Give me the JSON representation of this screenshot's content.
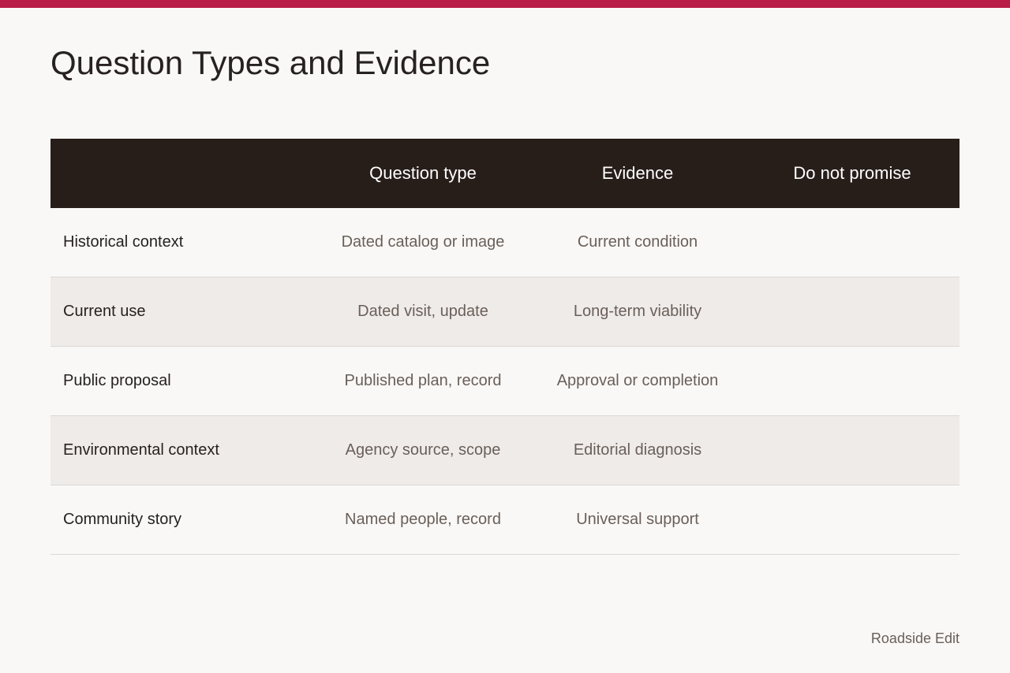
{
  "page": {
    "title": "Question Types and Evidence",
    "accent_color": "#b91d47",
    "footer": "Roadside Edit"
  },
  "table": {
    "headers": [
      "",
      "Question type",
      "Evidence",
      "Do not promise"
    ],
    "rows": [
      {
        "label": "Historical context",
        "question_type": "Dated catalog or image",
        "evidence": "Current condition",
        "do_not_promise": ""
      },
      {
        "label": "Current use",
        "question_type": "Dated visit, update",
        "evidence": "Long-term viability",
        "do_not_promise": ""
      },
      {
        "label": "Public proposal",
        "question_type": "Published plan, record",
        "evidence": "Approval or completion",
        "do_not_promise": ""
      },
      {
        "label": "Environmental context",
        "question_type": "Agency source, scope",
        "evidence": "Editorial diagnosis",
        "do_not_promise": ""
      },
      {
        "label": "Community story",
        "question_type": "Named people, record",
        "evidence": "Universal support",
        "do_not_promise": ""
      }
    ]
  }
}
